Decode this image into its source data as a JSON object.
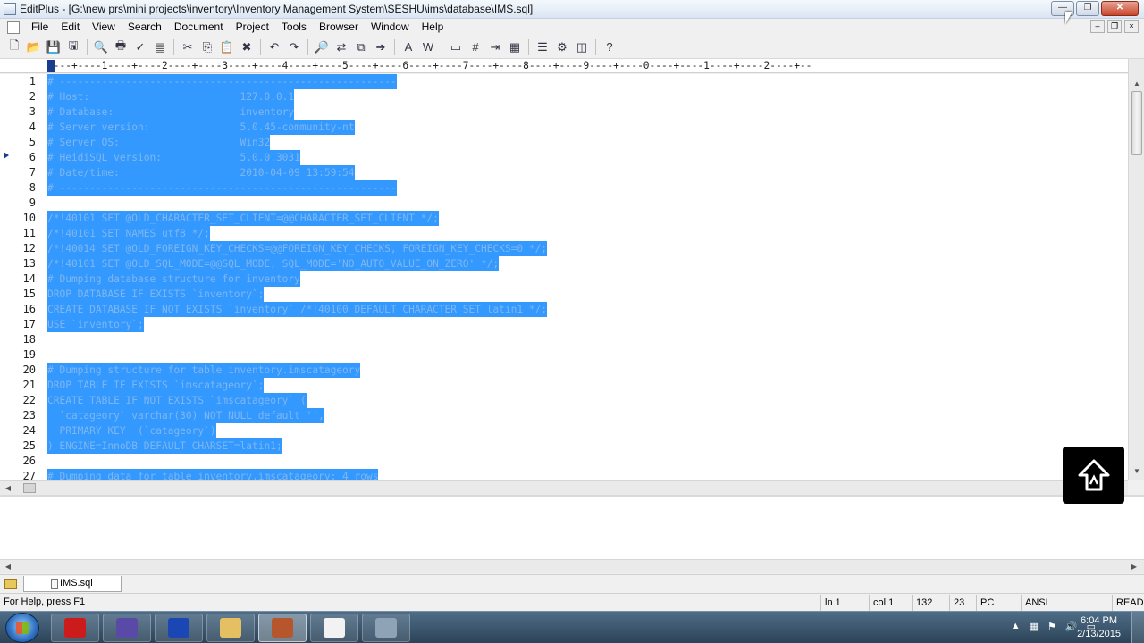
{
  "window": {
    "title": "EditPlus - [G:\\new prs\\mini projects\\inventory\\Inventory Management System\\SESHU\\ims\\database\\IMS.sql]",
    "minimize_label": "—",
    "maximize_label": "❐",
    "close_label": "✕"
  },
  "menu": {
    "items": [
      {
        "label": "File"
      },
      {
        "label": "Edit"
      },
      {
        "label": "View"
      },
      {
        "label": "Search"
      },
      {
        "label": "Document"
      },
      {
        "label": "Project"
      },
      {
        "label": "Tools"
      },
      {
        "label": "Browser"
      },
      {
        "label": "Window"
      },
      {
        "label": "Help"
      }
    ],
    "mdi_minimize": "–",
    "mdi_restore": "❐",
    "mdi_close": "×"
  },
  "toolbar": {
    "buttons": [
      {
        "icon": "new-file-icon",
        "glyph": "🗋"
      },
      {
        "icon": "open-file-icon",
        "glyph": "📂"
      },
      {
        "icon": "save-icon",
        "glyph": "💾"
      },
      {
        "icon": "save-all-icon",
        "glyph": "🖫"
      },
      {
        "icon": "print-preview-icon",
        "glyph": "🔍"
      },
      {
        "icon": "print-icon",
        "glyph": "🖶"
      },
      {
        "icon": "spellcheck-icon",
        "glyph": "✓"
      },
      {
        "icon": "html-toolbar-icon",
        "glyph": "▤"
      },
      {
        "icon": "cut-icon",
        "glyph": "✂"
      },
      {
        "icon": "copy-icon",
        "glyph": "⎘"
      },
      {
        "icon": "paste-icon",
        "glyph": "📋"
      },
      {
        "icon": "delete-icon",
        "glyph": "✖"
      },
      {
        "icon": "undo-icon",
        "glyph": "↶"
      },
      {
        "icon": "redo-icon",
        "glyph": "↷"
      },
      {
        "icon": "find-icon",
        "glyph": "🔎"
      },
      {
        "icon": "replace-icon",
        "glyph": "⇄"
      },
      {
        "icon": "find-in-files-icon",
        "glyph": "⧉"
      },
      {
        "icon": "goto-icon",
        "glyph": "➔"
      },
      {
        "icon": "font-icon",
        "glyph": "A"
      },
      {
        "icon": "word-wrap-icon",
        "glyph": "W"
      },
      {
        "icon": "ruler-icon",
        "glyph": "▭"
      },
      {
        "icon": "line-number-icon",
        "glyph": "#"
      },
      {
        "icon": "tab-icon",
        "glyph": "⇥"
      },
      {
        "icon": "directory-window-icon",
        "glyph": "▦"
      },
      {
        "icon": "cliptext-icon",
        "glyph": "☰"
      },
      {
        "icon": "user-tool-icon",
        "glyph": "⚙"
      },
      {
        "icon": "browser-icon",
        "glyph": "◫"
      },
      {
        "icon": "help-icon",
        "glyph": "?"
      }
    ]
  },
  "ruler": {
    "text": "----+----1----+----2----+----3----+----4----+----5----+----6----+----7----+----8----+----9----+----0----+----1----+----2----+--"
  },
  "editor": {
    "lines": [
      {
        "num": "1",
        "text": "# --------------------------------------------------------"
      },
      {
        "num": "2",
        "text": "# Host:                         127.0.0.1"
      },
      {
        "num": "3",
        "text": "# Database:                     inventory"
      },
      {
        "num": "4",
        "text": "# Server version:               5.0.45-community-nt"
      },
      {
        "num": "5",
        "text": "# Server OS:                    Win32"
      },
      {
        "num": "6",
        "text": "# HeidiSQL version:             5.0.0.3031"
      },
      {
        "num": "7",
        "text": "# Date/time:                    2010-04-09 13:59:54"
      },
      {
        "num": "8",
        "text": "# --------------------------------------------------------"
      },
      {
        "num": "9",
        "text": ""
      },
      {
        "num": "10",
        "text": "/*!40101 SET @OLD_CHARACTER_SET_CLIENT=@@CHARACTER_SET_CLIENT */;"
      },
      {
        "num": "11",
        "text": "/*!40101 SET NAMES utf8 */;"
      },
      {
        "num": "12",
        "text": "/*!40014 SET @OLD_FOREIGN_KEY_CHECKS=@@FOREIGN_KEY_CHECKS, FOREIGN_KEY_CHECKS=0 */;"
      },
      {
        "num": "13",
        "text": "/*!40101 SET @OLD_SQL_MODE=@@SQL_MODE, SQL_MODE='NO_AUTO_VALUE_ON_ZERO' */;"
      },
      {
        "num": "14",
        "text": "# Dumping database structure for inventory"
      },
      {
        "num": "15",
        "text": "DROP DATABASE IF EXISTS `inventory`;"
      },
      {
        "num": "16",
        "text": "CREATE DATABASE IF NOT EXISTS `inventory` /*!40100 DEFAULT CHARACTER SET latin1 */;"
      },
      {
        "num": "17",
        "text": "USE `inventory`;"
      },
      {
        "num": "18",
        "text": ""
      },
      {
        "num": "19",
        "text": ""
      },
      {
        "num": "20",
        "text": "# Dumping structure for table inventory.imscatageory"
      },
      {
        "num": "21",
        "text": "DROP TABLE IF EXISTS `imscatageory`;"
      },
      {
        "num": "22",
        "text": "CREATE TABLE IF NOT EXISTS `imscatageory` ("
      },
      {
        "num": "23",
        "text": "  `catageory` varchar(30) NOT NULL default '',"
      },
      {
        "num": "24",
        "text": "  PRIMARY KEY  (`catageory`)"
      },
      {
        "num": "25",
        "text": ") ENGINE=InnoDB DEFAULT CHARSET=latin1;"
      },
      {
        "num": "26",
        "text": ""
      },
      {
        "num": "27",
        "text": "# Dumping data for table inventory.imscatageory: 4 rows"
      }
    ]
  },
  "tabs": [
    {
      "label": "IMS.sql",
      "active": true
    }
  ],
  "status": {
    "help": "For Help, press F1",
    "line": "ln 1",
    "col": "col 1",
    "total_lines": "132",
    "extra": "23",
    "line_ending": "PC",
    "encoding": "ANSI",
    "mode": "READ"
  },
  "taskbar": {
    "time": "6:04 PM",
    "date": "2/13/2015",
    "apps": [
      {
        "icon": "opera-icon",
        "color": "#cc1b1b"
      },
      {
        "icon": "media-player-icon",
        "color": "#5a4aa8"
      },
      {
        "icon": "editplus-icon",
        "color": "#1b47b5"
      },
      {
        "icon": "file-explorer-icon",
        "color": "#e4c063"
      },
      {
        "icon": "sql-editor-icon",
        "color": "#b5562c"
      },
      {
        "icon": "book-reader-icon",
        "color": "#f2f2f2"
      },
      {
        "icon": "tools-icon",
        "color": "#8ea3b5"
      }
    ]
  },
  "colors": {
    "selection": "#3399ff",
    "selected_text": "#7fb6ef",
    "taskbar": "#3b566e"
  }
}
